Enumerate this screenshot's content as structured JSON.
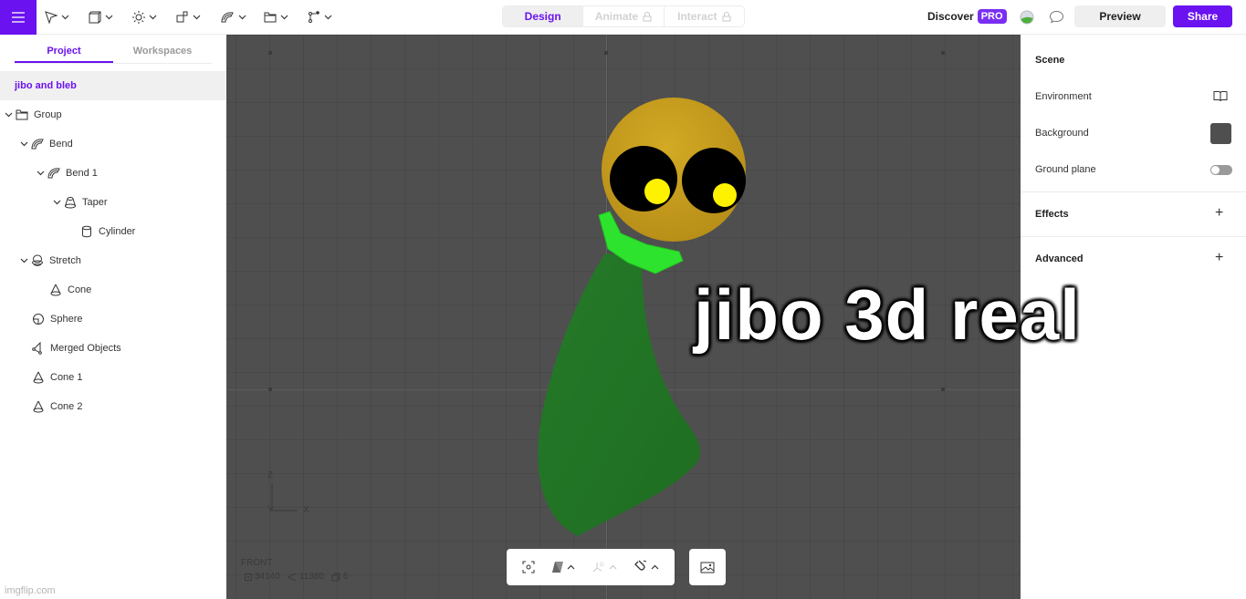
{
  "topbar": {
    "menu_icon": "hamburger-icon",
    "tools": [
      {
        "name": "select-tool",
        "icon": "cursor-arrow-icon"
      },
      {
        "name": "object-tool",
        "icon": "cube-icon"
      },
      {
        "name": "light-tool",
        "icon": "sun-icon"
      },
      {
        "name": "shapes-tool",
        "icon": "shapes-icon"
      },
      {
        "name": "modifier-tool",
        "icon": "bend-icon"
      },
      {
        "name": "group-tool",
        "icon": "folder-icon"
      },
      {
        "name": "path-tool",
        "icon": "node-path-icon"
      }
    ],
    "modes": [
      {
        "label": "Design",
        "active": true,
        "locked": false
      },
      {
        "label": "Animate",
        "active": false,
        "locked": true
      },
      {
        "label": "Interact",
        "active": false,
        "locked": true
      }
    ],
    "discover_label": "Discover",
    "pro_badge": "PRO",
    "preview_label": "Preview",
    "share_label": "Share"
  },
  "left_panel": {
    "tabs": [
      {
        "label": "Project",
        "active": true
      },
      {
        "label": "Workspaces",
        "active": false
      }
    ],
    "project_name": "jibo and bleb",
    "tree": [
      {
        "label": "Group",
        "icon": "folder-icon",
        "depth": 0,
        "expanded": true
      },
      {
        "label": "Bend",
        "icon": "bend-icon",
        "depth": 1,
        "expanded": true
      },
      {
        "label": "Bend 1",
        "icon": "bend-icon",
        "depth": 2,
        "expanded": true
      },
      {
        "label": "Taper",
        "icon": "taper-icon",
        "depth": 3,
        "expanded": true
      },
      {
        "label": "Cylinder",
        "icon": "cylinder-icon",
        "depth": 4,
        "expanded": null
      },
      {
        "label": "Stretch",
        "icon": "stretch-icon",
        "depth": 1,
        "expanded": true
      },
      {
        "label": "Cone",
        "icon": "cone-icon",
        "depth": 2,
        "expanded": null
      },
      {
        "label": "Sphere",
        "icon": "sphere-icon",
        "depth": 1,
        "expanded": null
      },
      {
        "label": "Merged Objects",
        "icon": "merged-icon",
        "depth": 1,
        "expanded": null
      },
      {
        "label": "Cone 1",
        "icon": "cone-icon",
        "depth": 1,
        "expanded": null
      },
      {
        "label": "Cone 2",
        "icon": "cone-icon",
        "depth": 1,
        "expanded": null
      }
    ]
  },
  "viewport": {
    "gizmo": {
      "z": "Z",
      "y": "Y",
      "x": "X"
    },
    "view_name": "FRONT",
    "stats": {
      "vertices": "34140",
      "triangles": "11380",
      "objects": "6"
    },
    "background_color": "#4f4f4f",
    "caption": "jibo 3d real"
  },
  "right_panel": {
    "scene_title": "Scene",
    "environment_label": "Environment",
    "background_label": "Background",
    "background_color": "#4f4f4f",
    "ground_plane_label": "Ground plane",
    "ground_plane_on": false,
    "effects_title": "Effects",
    "advanced_title": "Advanced"
  },
  "colors": {
    "accent": "#6a12f0",
    "head": "#c9a020",
    "body": "#237c27",
    "collar": "#2ee32e",
    "pupil": "#fff200"
  },
  "watermark": "imgflip.com"
}
